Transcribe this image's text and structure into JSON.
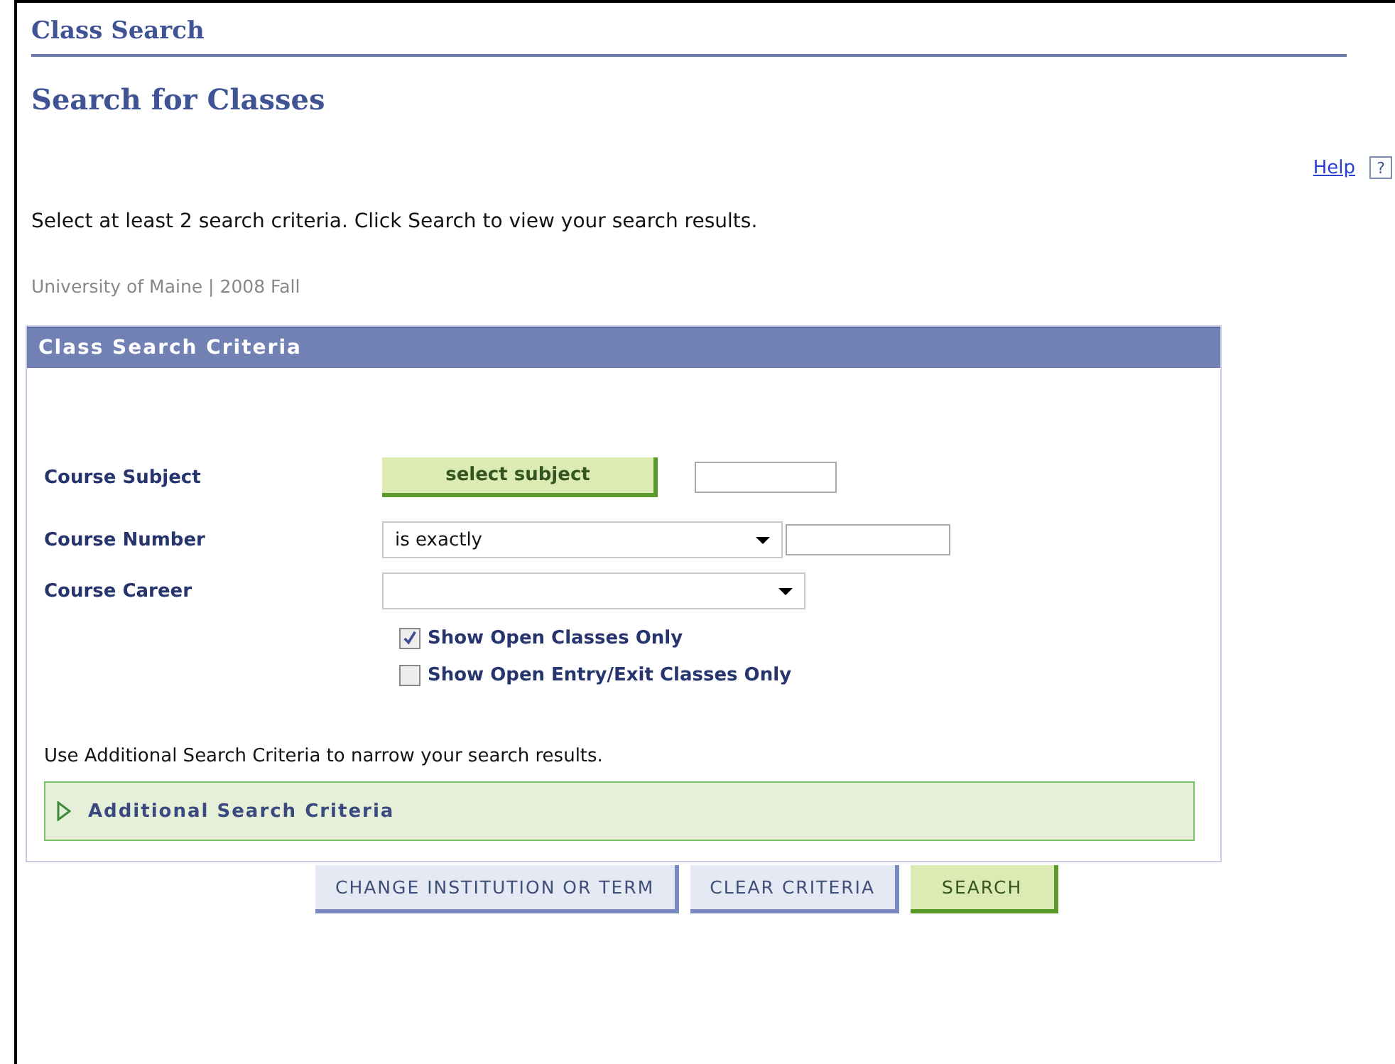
{
  "page": {
    "title": "Class Search",
    "subtitle": "Search for Classes"
  },
  "help": {
    "link": "Help",
    "icon_text": "?"
  },
  "instructions": "Select at least 2 search criteria. Click Search to view your search results.",
  "context": "University of Maine | 2008 Fall",
  "panel": {
    "title": "Class Search Criteria",
    "fields": [
      {
        "kind": "button",
        "label": "Course Subject",
        "button": "select subject"
      },
      {
        "kind": "select_input",
        "label": "Course Number",
        "value": "is exactly"
      },
      {
        "kind": "select",
        "label": "Course Career"
      }
    ],
    "checkboxes": [
      {
        "label": "Show Open Classes Only",
        "checked": true
      },
      {
        "label": "Show Open Entry/Exit Classes Only",
        "checked": false
      }
    ],
    "hint": "Use Additional Search Criteria to narrow your search results.",
    "additional": {
      "label": "Additional Search Criteria",
      "expanded": false
    }
  },
  "buttons": [
    {
      "label": "CHANGE INSTITUTION OR TERM",
      "kind": "secondary"
    },
    {
      "label": "CLEAR CRITERIA",
      "kind": "secondary"
    },
    {
      "label": "SEARCH",
      "kind": "primary"
    }
  ]
}
